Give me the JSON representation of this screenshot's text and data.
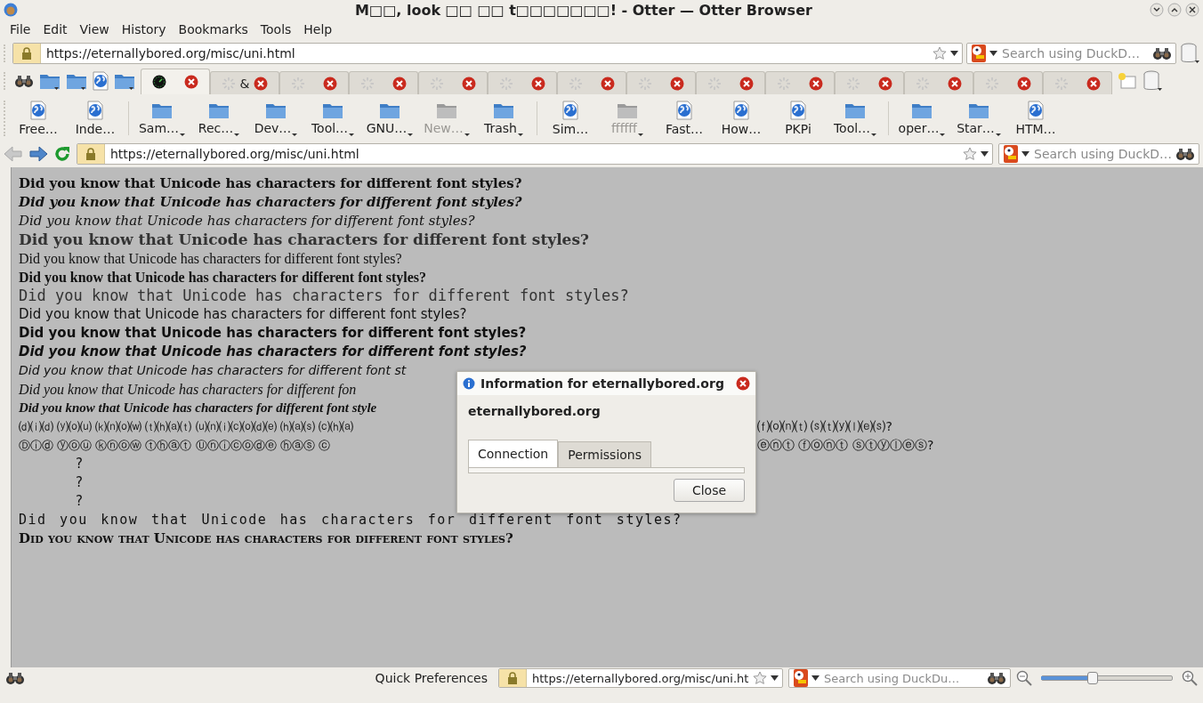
{
  "window": {
    "title": "M□□, look □□ □□ t□□□□□□□! - Otter — Otter Browser"
  },
  "menu": [
    "File",
    "Edit",
    "View",
    "History",
    "Bookmarks",
    "Tools",
    "Help"
  ],
  "address_bar": {
    "url": "https://eternallybored.org/misc/uni.html",
    "search_placeholder": "Search using DuckD…"
  },
  "tabs": [
    {
      "selected": true,
      "loading": false
    },
    {
      "label": "&",
      "selected": false,
      "loading": true
    },
    {
      "selected": false,
      "loading": true
    },
    {
      "selected": false,
      "loading": true
    },
    {
      "selected": false,
      "loading": true
    },
    {
      "selected": false,
      "loading": true
    },
    {
      "selected": false,
      "loading": true
    },
    {
      "selected": false,
      "loading": true
    },
    {
      "selected": false,
      "loading": true
    },
    {
      "selected": false,
      "loading": true
    },
    {
      "selected": false,
      "loading": true
    },
    {
      "selected": false,
      "loading": true
    },
    {
      "selected": false,
      "loading": true
    },
    {
      "selected": false,
      "loading": true
    }
  ],
  "bookmarks": [
    {
      "kind": "page",
      "label": "Free…",
      "disabled": false
    },
    {
      "kind": "page",
      "label": "Inde…",
      "disabled": false
    },
    {
      "kind": "separator"
    },
    {
      "kind": "folder",
      "label": "Sam…",
      "disabled": false
    },
    {
      "kind": "folder",
      "label": "Rec…",
      "disabled": false
    },
    {
      "kind": "folder",
      "label": "Dev…",
      "disabled": false
    },
    {
      "kind": "folder",
      "label": "Tool…",
      "disabled": false
    },
    {
      "kind": "folder",
      "label": "GNU…",
      "disabled": false
    },
    {
      "kind": "folder",
      "label": "New…",
      "disabled": true
    },
    {
      "kind": "folder",
      "label": "Trash",
      "disabled": false
    },
    {
      "kind": "separator"
    },
    {
      "kind": "page",
      "label": "Sim…",
      "disabled": false
    },
    {
      "kind": "folder",
      "label": "ffffff",
      "disabled": true
    },
    {
      "kind": "page",
      "label": "Fast…",
      "disabled": false
    },
    {
      "kind": "page",
      "label": "How…",
      "disabled": false
    },
    {
      "kind": "page",
      "label": "PKPi",
      "disabled": false
    },
    {
      "kind": "folder",
      "label": "Tool…",
      "disabled": false
    },
    {
      "kind": "separator"
    },
    {
      "kind": "folder",
      "label": "oper…",
      "disabled": false
    },
    {
      "kind": "folder",
      "label": "Star…",
      "disabled": false
    },
    {
      "kind": "page",
      "label": "HTM…",
      "disabled": false
    }
  ],
  "nav_bar": {
    "back": {
      "disabled": true
    },
    "forward": {
      "disabled": false
    },
    "url": "https://eternallybored.org/misc/uni.html",
    "search_placeholder": "Search using DuckD…"
  },
  "content_lines": [
    {
      "kind": "serif-bold",
      "text": "Did you know that Unicode has characters for different font styles?"
    },
    {
      "kind": "serif-bold-italic",
      "text": "Did you know that Unicode has characters for different font styles?"
    },
    {
      "kind": "serif-italic",
      "text": "Did you know that Unicode has characters for different font styles?"
    },
    {
      "kind": "double-struck",
      "text": "Did you know that Unicode has characters for different font styles?"
    },
    {
      "kind": "fraktur",
      "text": "Did you know that Unicode has characters for different font styles?"
    },
    {
      "kind": "fraktur-bold",
      "text": "Did you know that Unicode has characters for different font styles?"
    },
    {
      "kind": "monospace",
      "text": "Did you know that Unicode has characters for different font styles?"
    },
    {
      "kind": "sans",
      "text": "Did you know that Unicode has characters for different font styles?"
    },
    {
      "kind": "sans-bold",
      "text": "Did you know that Unicode has characters for different font styles?"
    },
    {
      "kind": "sans-bold-italic",
      "text": "Did you know that Unicode has characters for different font styles?"
    },
    {
      "kind": "sans-italic",
      "text": "Did you know that Unicode has characters for different font st"
    },
    {
      "kind": "script",
      "text": "Did you know that Unicode has characters for different fon"
    },
    {
      "kind": "script-bold",
      "text": "Did you know that Unicode has characters for different font style"
    },
    {
      "kind": "parenthesized",
      "text": "⒟⒤⒟ ⒴⒪⒰ ⒦⒩⒪⒲ ⒯⒣⒜⒯ ⒰⒩⒤⒞⒪⒟⒠ ⒣⒜⒮ ⒞⒣⒜",
      "text_right": "⒡⒪⒩⒯ ⒮⒯⒴⒧⒠⒮?"
    },
    {
      "kind": "circled",
      "text": "Ⓓⓘⓓ ⓨⓞⓤ ⓚⓝⓞⓦ ⓣⓗⓐⓣ Ⓤⓝⓘⓒⓞⓓⓔ ⓗⓐⓢ ⓒ",
      "text_right": "ⓔⓝⓣ ⓕⓞⓝⓣ ⓢⓣⓨⓛⓔⓢ?"
    },
    {
      "kind": "indented",
      "text": "?"
    },
    {
      "kind": "indented",
      "text": "?"
    },
    {
      "kind": "indented",
      "text": "?"
    },
    {
      "kind": "spaced",
      "text": "Did you know that Unicode has characters for different font styles?"
    },
    {
      "kind": "small-caps",
      "text": "Did you know that Unicode has characters for different font styles?"
    }
  ],
  "dialog": {
    "title": "Information for eternallybored.org",
    "host": "eternallybored.org",
    "tabs": [
      {
        "label": "Connection",
        "selected": true
      },
      {
        "label": "Permissions",
        "selected": false
      }
    ],
    "button": "Close"
  },
  "status_bar": {
    "label": "Quick Preferences",
    "url": "https://eternallybored.org/misc/uni.ht",
    "search_placeholder": "Search using DuckDu…",
    "zoom": {
      "level": 0.39
    }
  }
}
